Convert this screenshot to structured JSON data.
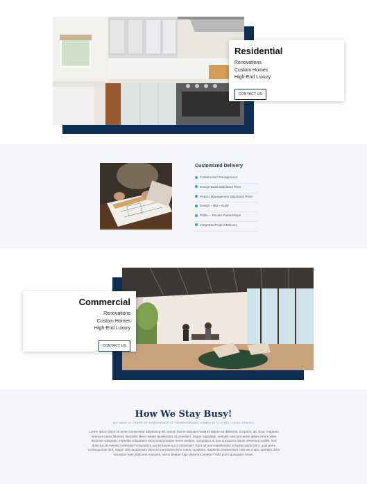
{
  "residential": {
    "title": "Residential",
    "lines": [
      "Renovations",
      "Custom Homes",
      "High-End Luxury"
    ],
    "button": "CONTACT US"
  },
  "delivery": {
    "heading": "Customized Delivery",
    "items": [
      "Construction Management",
      "Design-Build Stipulated Price",
      "Project Management Stipulated Price",
      "Design – Bid – Build",
      "Public – Private Partnerships",
      "Integrated Project Delivery"
    ]
  },
  "commercial": {
    "title": "Commercial",
    "lines": [
      "Renovations",
      "Custom Homes",
      "High-End Luxury"
    ],
    "button": "CONTACT US"
  },
  "busy": {
    "title": "How We Stay Busy!",
    "subtitle": "WE HAVE 25 YEARS OF EXPERIENCE IN TRANSFORMING HOMES INTO IDEAL LIVING SPACES",
    "paragraph": "Lorem ipsum dolor sit amet consectetur adipisicing elit. Ipsum facere aliquam maiores labore ea distinctio. Corporis, ab. Eius, magnam nesciunt natus laborum blanditiis libero saepe repellendus at provident. Itaque cupiditate, veritatis nesciunt animi ipsam rerum vitae ducimus voluptate, expedita voluptatem laboriosam beatae nemo quidem. Voluptas a ut quo quisquam dolore deserunt mollitia, sed delectus sit eveniet molestiae! Voluptatum aut sit itaque qui a molestiae? Sunt ad eum repellendus voluptas aspernatur, quia porro consequuntur sint, magni odio laudantium laborum numquam error natus cupiditate. Sapiente praesentium cum est culpa, aperiam dicta excepturi exercitationem maiores, nemo beatae fuga deserunt ametur? Nihil porro quisquam rerum."
  }
}
